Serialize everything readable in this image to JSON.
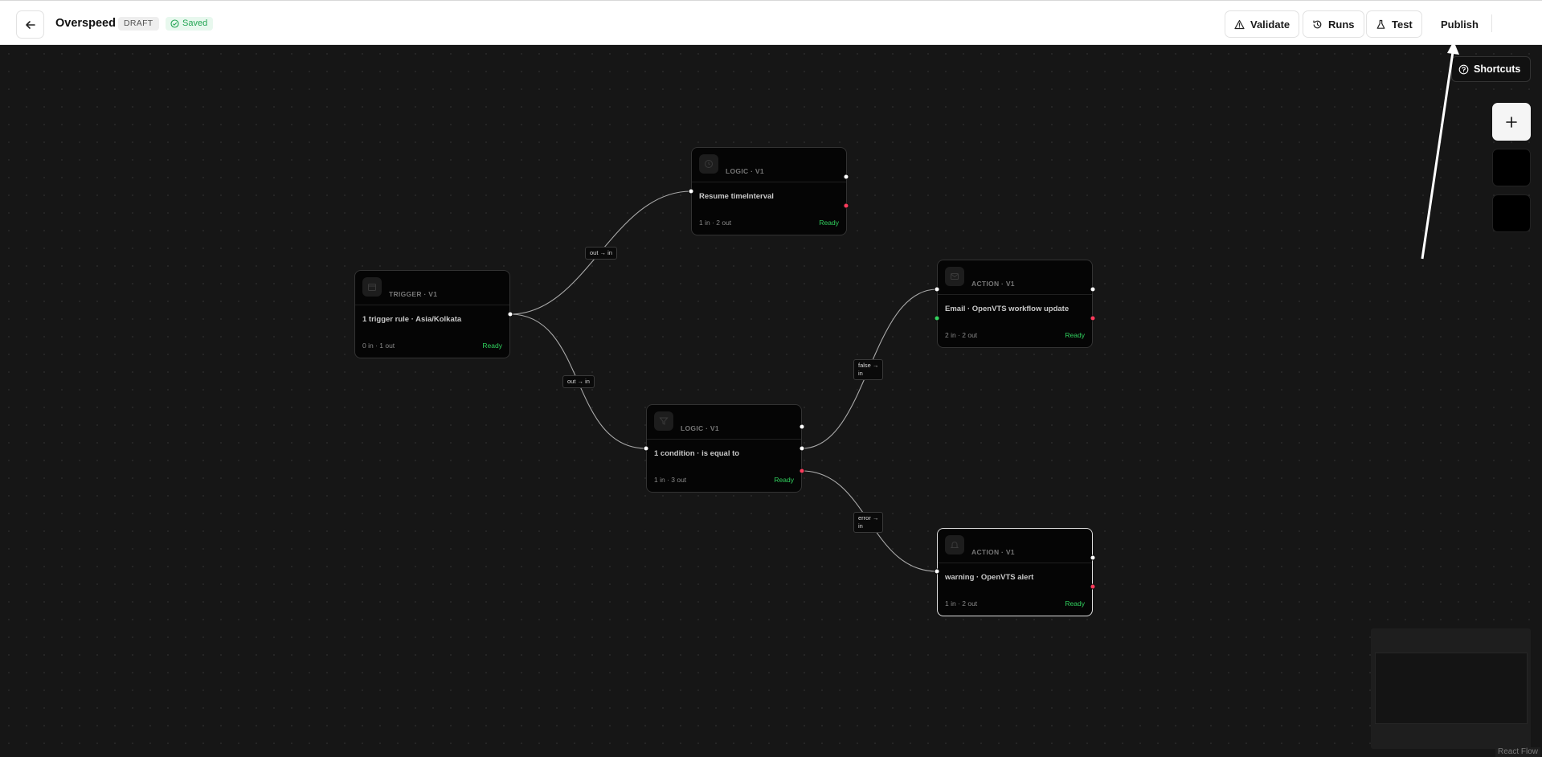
{
  "header": {
    "back_icon": "arrow-left-icon",
    "title": "Overspeed",
    "status_badge": "DRAFT",
    "saved_label": "Saved",
    "actions": [
      {
        "label": "Validate",
        "icon": "warning-triangle-icon"
      },
      {
        "label": "Runs",
        "icon": "history-icon"
      },
      {
        "label": "Test",
        "icon": "flask-icon"
      },
      {
        "label": "Publish",
        "icon": ""
      }
    ]
  },
  "canvas": {
    "shortcuts_label": "Shortcuts",
    "side_buttons": [
      "plus-icon",
      "",
      ""
    ],
    "nodes": [
      {
        "id": "trigger",
        "kind": "TRIGGER · V1",
        "title": "1 trigger rule · Asia/Kolkata",
        "io": "0 in · 1 out",
        "status": "Ready",
        "icon": "calendar-icon"
      },
      {
        "id": "logic-resume",
        "kind": "LOGIC · V1",
        "title": "Resume timeInterval",
        "io": "1 in · 2 out",
        "status": "Ready",
        "icon": "clock-icon"
      },
      {
        "id": "logic-condition",
        "kind": "LOGIC · V1",
        "title": "1 condition · is equal to",
        "io": "1 in · 3 out",
        "status": "Ready",
        "icon": "filter-icon"
      },
      {
        "id": "action-email",
        "kind": "ACTION · V1",
        "title": "Email · OpenVTS workflow update",
        "io": "2 in · 2 out",
        "status": "Ready",
        "icon": "mail-icon"
      },
      {
        "id": "action-warning",
        "kind": "ACTION · V1",
        "title": "warning · OpenVTS alert",
        "io": "1 in · 2 out",
        "status": "Ready",
        "icon": "bell-icon"
      }
    ],
    "edge_labels": [
      {
        "from": "trigger",
        "to": "logic-resume",
        "label_line1": "out → in",
        "label_line2": ""
      },
      {
        "from": "trigger",
        "to": "logic-condition",
        "label_line1": "out → in",
        "label_line2": ""
      },
      {
        "from": "logic-condition",
        "to": "action-email",
        "label_line1": "false →",
        "label_line2": "in"
      },
      {
        "from": "logic-condition",
        "to": "action-warning",
        "label_line1": "error →",
        "label_line2": "in"
      }
    ],
    "attribution": "React Flow"
  },
  "colors": {
    "canvas_bg": "#161616",
    "node_bg": "#050505",
    "ready_green": "#31d35f",
    "error_handle_red": "#ff3b5c",
    "saved_green": "#22a553"
  }
}
